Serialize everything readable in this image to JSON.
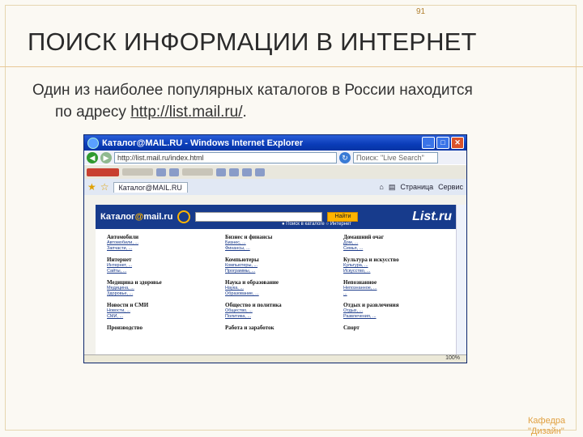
{
  "slide": {
    "page_number": "91",
    "title": "ПОИСК ИНФОРМАЦИИ В ИНТЕРНЕТ",
    "line1": "Один из наиболее популярных каталогов в России находится",
    "line2_prefix": "по адресу ",
    "link": "http://list.mail.ru/",
    "line2_suffix": ".",
    "footer_1": "Кафедра",
    "footer_2": "\"Дизайн\""
  },
  "browser": {
    "window_title": "Каталог@MAIL.RU - Windows Internet Explorer",
    "address": "http://list.mail.ru/index.html",
    "search_placeholder": "Поиск: \"Live Search\"",
    "tab_label": "Каталог@MAIL.RU",
    "tools_page": "Страница",
    "tools_service": "Сервис",
    "zoom": "100%"
  },
  "site": {
    "brand_pre": "Каталог",
    "brand_at": "@",
    "brand_post": "mail.ru",
    "search_button": "Найти",
    "radio_1": "Поиск в каталоге",
    "radio_2": "Интернет",
    "logo": "List.ru",
    "categories": [
      {
        "h": "Автомобили",
        "s": [
          "Автомобили, ...",
          "Запчасти, ..."
        ]
      },
      {
        "h": "Бизнес и финансы",
        "s": [
          "Бизнес, ...",
          "Финансы, ..."
        ]
      },
      {
        "h": "Домашний очаг",
        "s": [
          "Дом, ...",
          "Семья, ..."
        ]
      },
      {
        "h": "Интернет",
        "s": [
          "Интернет, ...",
          "Сайты, ..."
        ]
      },
      {
        "h": "Компьютеры",
        "s": [
          "Компьютеры, ...",
          "Программы, ..."
        ]
      },
      {
        "h": "Культура и искусство",
        "s": [
          "Культура, ...",
          "Искусство, ..."
        ]
      },
      {
        "h": "Медицина и здоровье",
        "s": [
          "Медицина, ...",
          "Здоровье, ..."
        ]
      },
      {
        "h": "Наука и образование",
        "s": [
          "Наука, ...",
          "Образование, ..."
        ]
      },
      {
        "h": "Непознанное",
        "s": [
          "Непознанное, ...",
          "..."
        ]
      },
      {
        "h": "Новости и СМИ",
        "s": [
          "Новости, ...",
          "СМИ, ..."
        ]
      },
      {
        "h": "Общество и политика",
        "s": [
          "Общество, ...",
          "Политика, ..."
        ]
      },
      {
        "h": "Отдых и развлечения",
        "s": [
          "Отдых, ...",
          "Развлечения, ..."
        ]
      },
      {
        "h": "Производство",
        "s": []
      },
      {
        "h": "Работа и заработок",
        "s": []
      },
      {
        "h": "Спорт",
        "s": []
      }
    ]
  }
}
